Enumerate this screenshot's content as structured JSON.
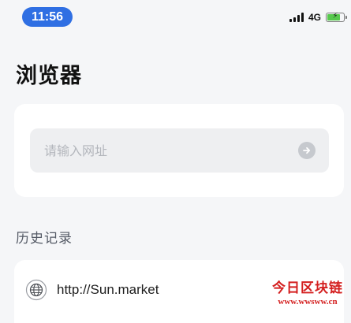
{
  "status_bar": {
    "time": "11:56",
    "network": "4G",
    "battery_level": 0.8,
    "icons": [
      "signal-icon",
      "battery-charging-icon"
    ]
  },
  "header": {
    "title": "浏览器"
  },
  "search": {
    "placeholder": "请输入网址",
    "value": "",
    "go_icon": "arrow-right-icon"
  },
  "history": {
    "heading": "历史记录",
    "items": [
      {
        "url": "http://Sun.market",
        "icon": "globe-icon"
      }
    ]
  },
  "watermark": {
    "title": "今日区块链",
    "url": "www.wwsww.cn"
  },
  "colors": {
    "accent": "#2f6fe3",
    "background": "#f5f6f8",
    "card": "#ffffff",
    "input_bg": "#eeeff1",
    "watermark": "#d42020"
  }
}
